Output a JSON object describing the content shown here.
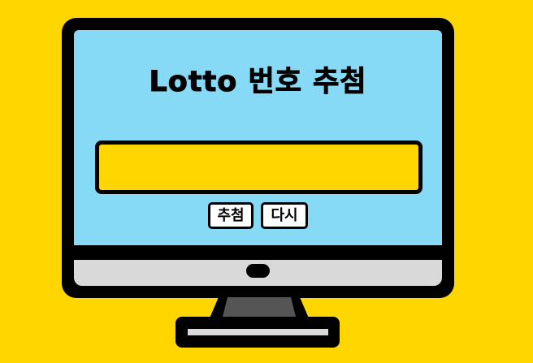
{
  "colors": {
    "background": "#FFD600",
    "screen": "#87DAF5",
    "display_field": "#FFD600",
    "frame": "#000000",
    "bezel": "#D9D9D9",
    "stand_neck": "#555555",
    "button": "#FFFFFF"
  },
  "app": {
    "title": "Lotto 번호 추첨"
  },
  "result_display": {
    "value": ""
  },
  "actions": {
    "draw_label": "추첨",
    "reset_label": "다시"
  },
  "icons": {
    "power": "power-button-icon"
  }
}
